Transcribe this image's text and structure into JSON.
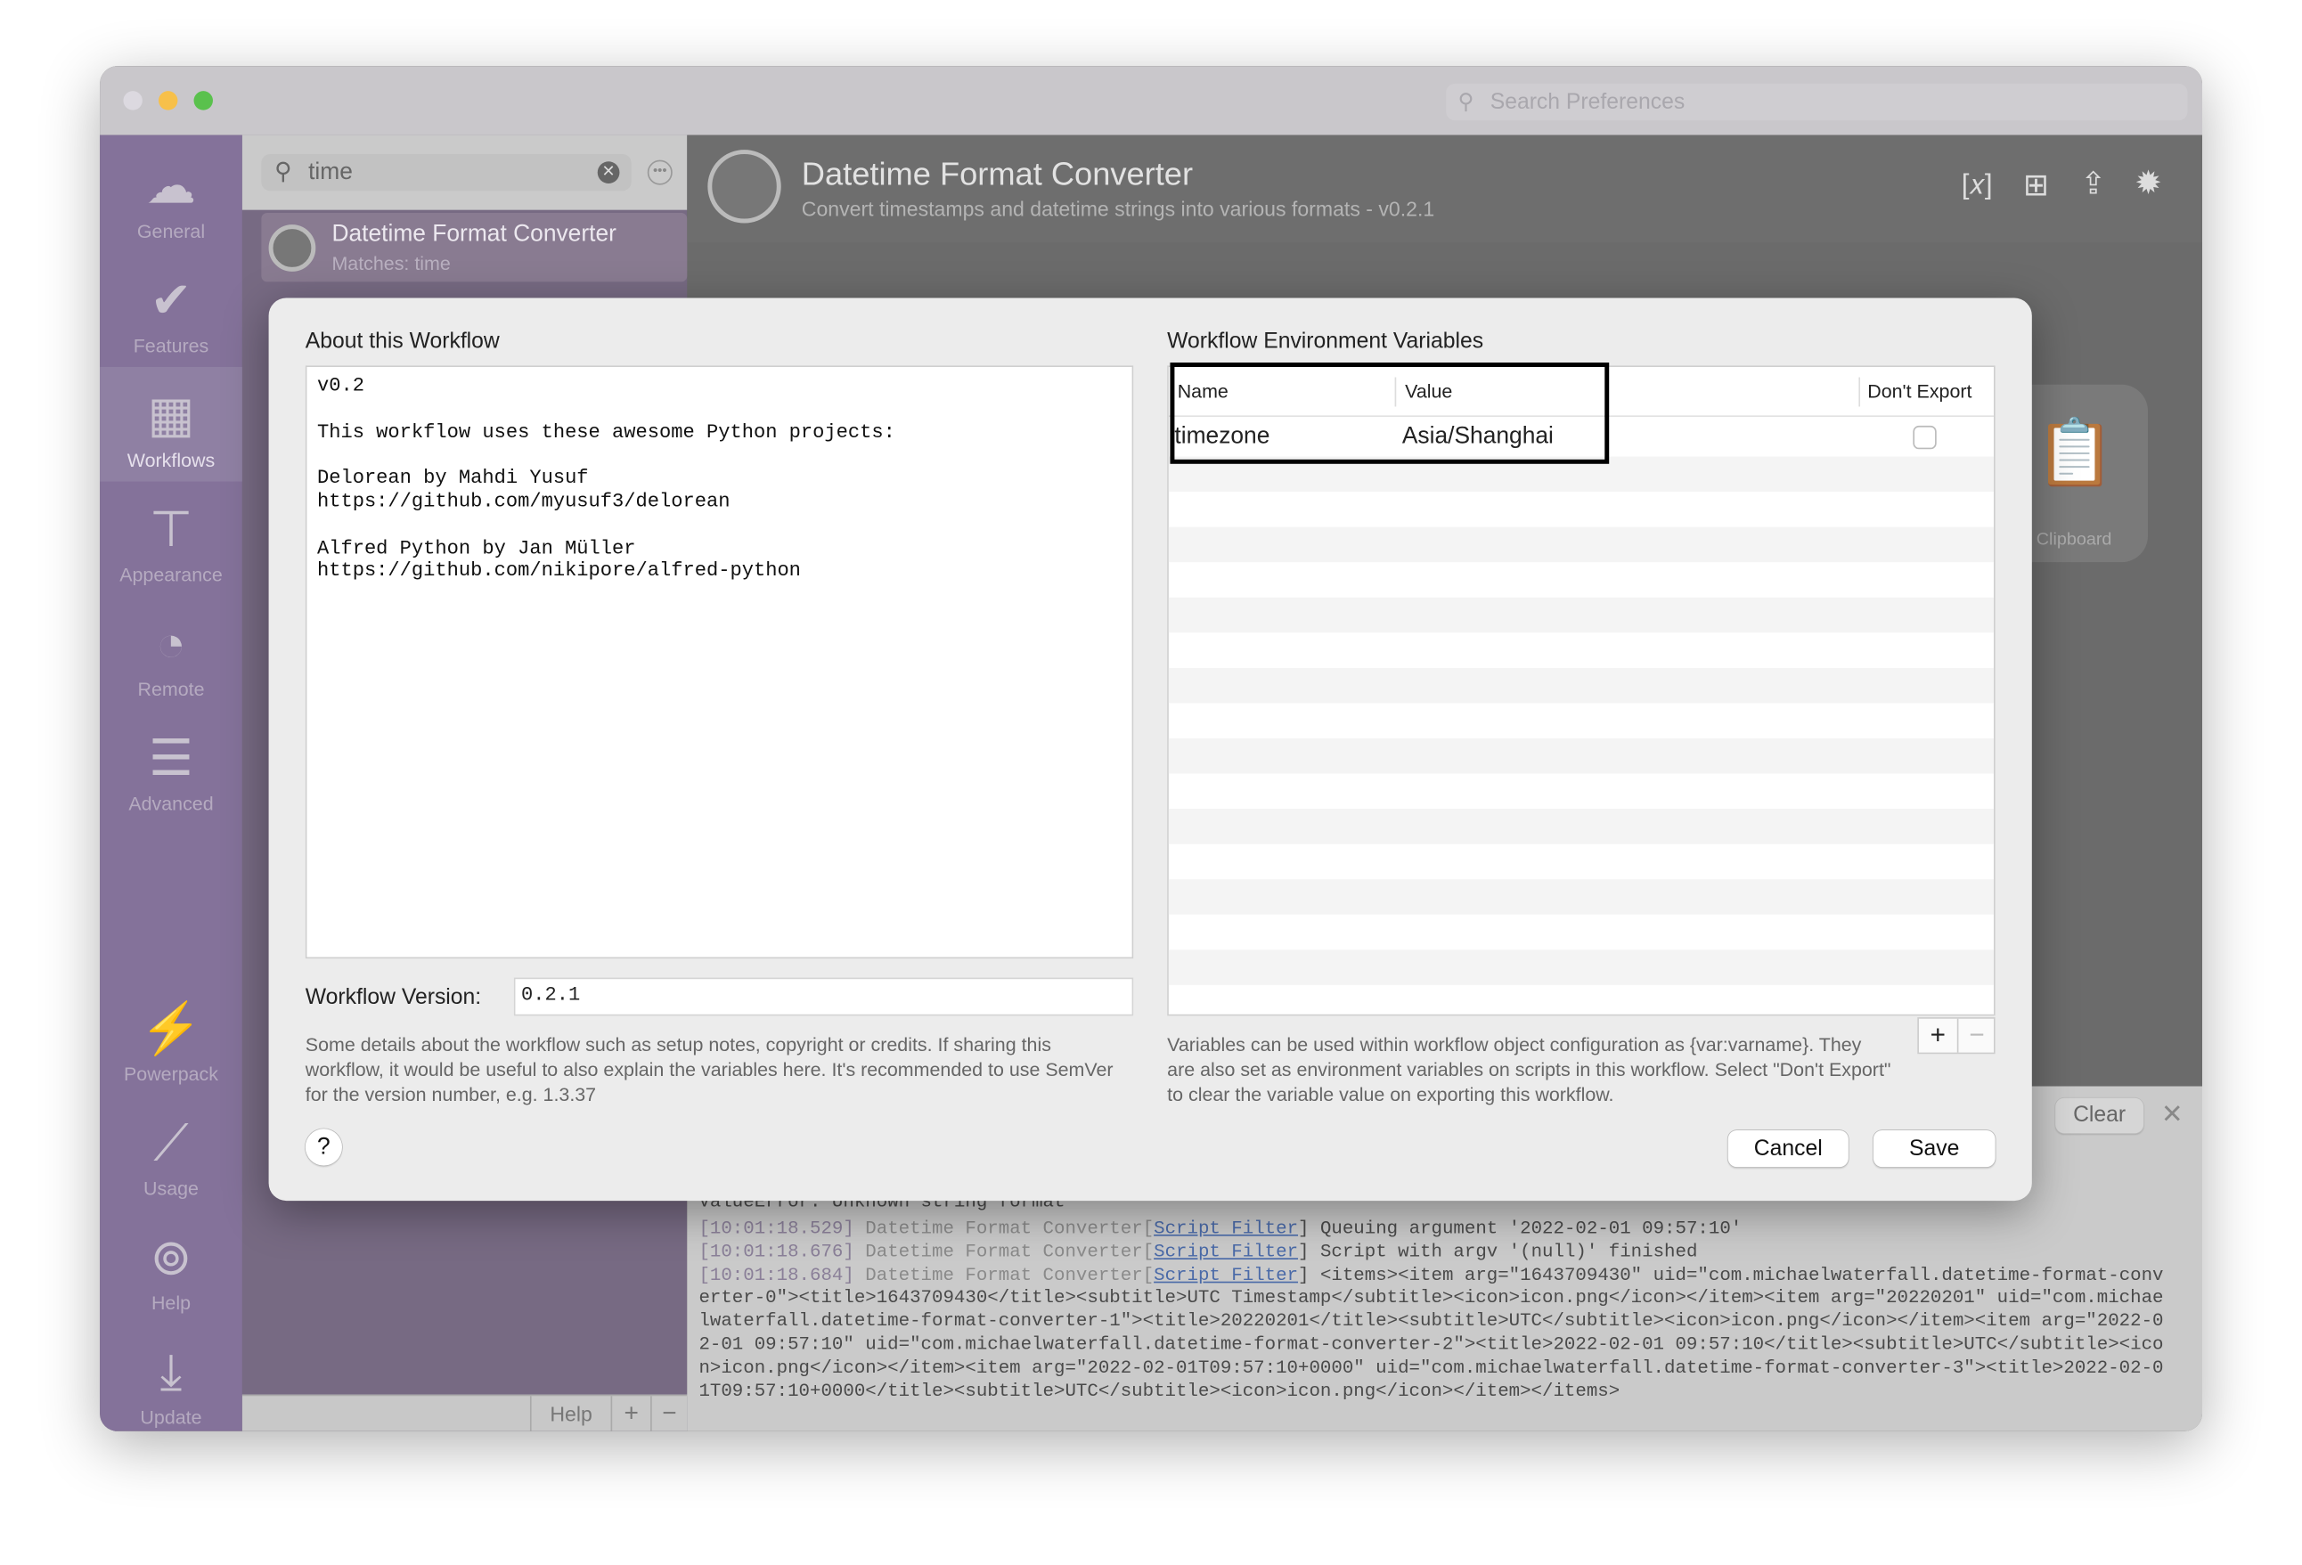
{
  "window": {
    "search_placeholder": "Search Preferences"
  },
  "sidebar": {
    "items": [
      {
        "label": "General",
        "icon": "hat-icon"
      },
      {
        "label": "Features",
        "icon": "checkmark-icon"
      },
      {
        "label": "Workflows",
        "icon": "grid-icon",
        "selected": true
      },
      {
        "label": "Appearance",
        "icon": "paint-roller-icon"
      },
      {
        "label": "Remote",
        "icon": "remote-icon"
      },
      {
        "label": "Advanced",
        "icon": "sliders-icon"
      }
    ],
    "bottom_items": [
      {
        "label": "Powerpack",
        "icon": "battery-bolt-icon"
      },
      {
        "label": "Usage",
        "icon": "chart-icon"
      },
      {
        "label": "Help",
        "icon": "lifebuoy-icon"
      },
      {
        "label": "Update",
        "icon": "download-icon"
      }
    ]
  },
  "list": {
    "search_value": "time",
    "results": [
      {
        "title": "Datetime Format Converter",
        "subtitle": "Matches: time"
      }
    ],
    "bottom": {
      "help": "Help",
      "add": "+",
      "remove": "−"
    }
  },
  "header": {
    "title": "Datetime Format Converter",
    "subtitle": "Convert timestamps and datetime strings into various formats - v0.2.1",
    "actions": [
      "variable-icon",
      "add-icon",
      "share-icon",
      "bug-icon"
    ]
  },
  "canvas": {
    "clipboard_label": "Clipboard"
  },
  "debug": {
    "clear": "Clear",
    "lines": [
      {
        "plain": "ValueError: Unknown string format"
      },
      {
        "ts": "[10:01:18.529]",
        "wf": " Datetime Format Converter[",
        "obj": "Script Filter",
        "msg": "] Queuing argument '2022-02-01 09:57:10'"
      },
      {
        "ts": "[10:01:18.676]",
        "wf": " Datetime Format Converter[",
        "obj": "Script Filter",
        "msg": "] Script with argv '(null)' finished"
      },
      {
        "ts": "[10:01:18.684]",
        "wf": " Datetime Format Converter[",
        "obj": "Script Filter",
        "msg": "] <items><item arg=\"1643709430\" uid=\"com.michaelwaterfall.datetime-format-converter-0\"><title>1643709430</title><subtitle>UTC Timestamp</subtitle><icon>icon.png</icon></item><item arg=\"20220201\" uid=\"com.michaelwaterfall.datetime-format-converter-1\"><title>20220201</title><subtitle>UTC</subtitle><icon>icon.png</icon></item><item arg=\"2022-02-01 09:57:10\" uid=\"com.michaelwaterfall.datetime-format-converter-2\"><title>2022-02-01 09:57:10</title><subtitle>UTC</subtitle><icon>icon.png</icon></item><item arg=\"2022-02-01T09:57:10+0000\" uid=\"com.michaelwaterfall.datetime-format-converter-3\"><title>2022-02-01T09:57:10+0000</title><subtitle>UTC</subtitle><icon>icon.png</icon></item></items>"
      }
    ]
  },
  "modal": {
    "about_title": "About this Workflow",
    "about_text": "v0.2\n\nThis workflow uses these awesome Python projects:\n\nDelorean by Mahdi Yusuf\nhttps://github.com/myusuf3/delorean\n\nAlfred Python by Jan Müller\nhttps://github.com/nikipore/alfred-python",
    "version_label": "Workflow Version:",
    "version_value": "0.2.1",
    "about_help": "Some details about the workflow such as setup notes, copyright or credits. If sharing this workflow, it would be useful to also explain the variables here. It's recommended to use SemVer for the version number, e.g. 1.3.37",
    "env_title": "Workflow Environment Variables",
    "columns": [
      "Name",
      "Value",
      "Don't Export"
    ],
    "rows": [
      {
        "name": "timezone",
        "value": "Asia/Shanghai",
        "dont_export": false
      }
    ],
    "env_help": "Variables can be used within workflow object configuration as {var:varname}. They are also set as environment variables on scripts in this workflow. Select \"Don't Export\" to clear the variable value on exporting this workflow.",
    "add": "+",
    "remove": "−",
    "help": "?",
    "cancel": "Cancel",
    "save": "Save"
  }
}
